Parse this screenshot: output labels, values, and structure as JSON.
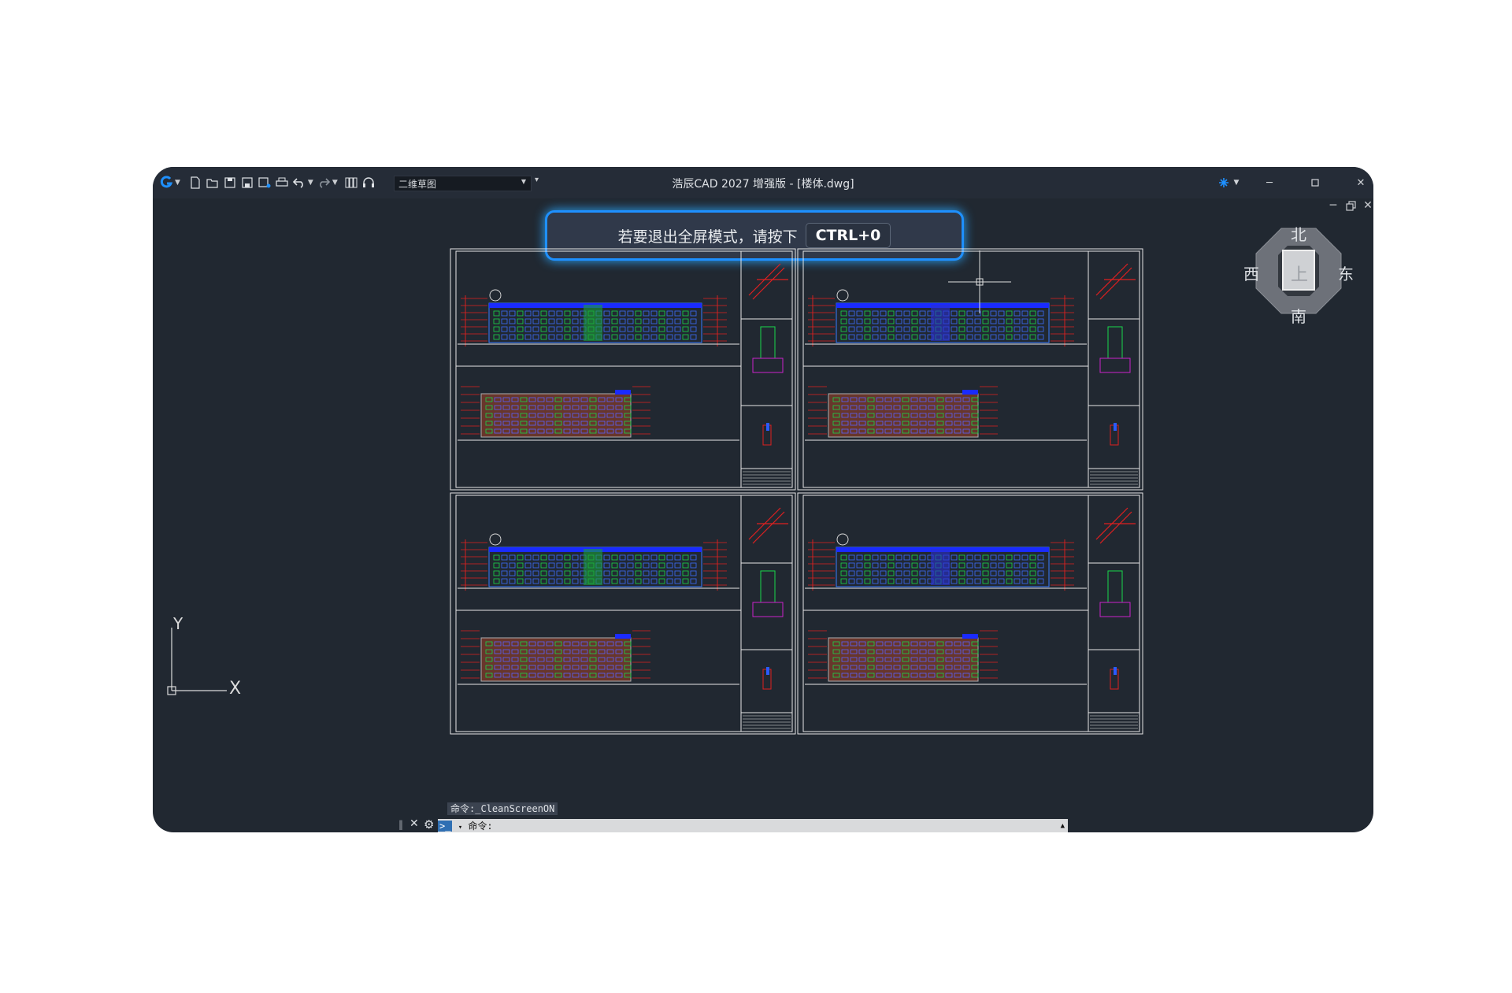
{
  "app": {
    "title": "浩辰CAD 2027 增强版 - [楼体.dwg]",
    "workspace": "二维草图",
    "accent_color": "#1e90ff"
  },
  "toast": {
    "message": "若要退出全屏模式，请按下",
    "shortcut": "CTRL+0"
  },
  "navcube": {
    "north": "北",
    "south": "南",
    "east": "东",
    "west": "西",
    "top": "上"
  },
  "ucs": {
    "x": "X",
    "y": "Y"
  },
  "command": {
    "history": "命令:_CleanScreenON",
    "prompt": "命令:"
  },
  "icons": [
    "app-logo-icon",
    "new-icon",
    "open-icon",
    "save-icon",
    "save-as-icon",
    "save-all-icon",
    "print-icon",
    "undo-icon",
    "redo-icon",
    "properties-icon",
    "headset-icon",
    "customize-icon",
    "cloud-icon",
    "minimize-icon",
    "maximize-icon",
    "close-icon",
    "settings-icon",
    "close-icon"
  ]
}
